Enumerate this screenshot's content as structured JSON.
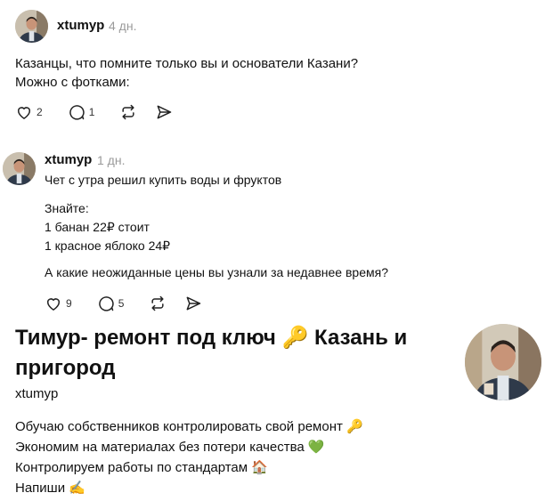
{
  "post1": {
    "username": "xtumyp",
    "time": "4 дн.",
    "lines": [
      "Казанцы, что помните только вы и основатели Казани?",
      "Можно с фотками:"
    ],
    "likes": "2",
    "replies": "1"
  },
  "post2": {
    "username": "xtumyp",
    "time": "1 дн.",
    "lines": [
      "Чет с утра решил купить воды и фруктов",
      "Знайте:",
      "1 банан 22₽ стоит",
      "1 красное яблоко 24₽",
      "А какие неожиданные цены вы узнали за недавнее время?"
    ],
    "likes": "9",
    "replies": "5"
  },
  "profile": {
    "title": "Тимур- ремонт под ключ 🔑 Казань и пригород",
    "handle": "xtumyp",
    "bio": [
      "Обучаю собственников контролировать свой ремонт 🔑",
      "Экономим на материалах без потери качества 💚",
      "Контролируем работы по стандартам 🏠",
      "Напиши ✍"
    ]
  },
  "colors": {
    "text": "#111111",
    "muted": "#9a9a9a",
    "icon": "#222222"
  },
  "icons": [
    "heart-icon",
    "comment-icon",
    "repost-icon",
    "share-icon",
    "key-emoji",
    "green-heart-emoji",
    "house-emoji",
    "writing-hand-emoji"
  ]
}
